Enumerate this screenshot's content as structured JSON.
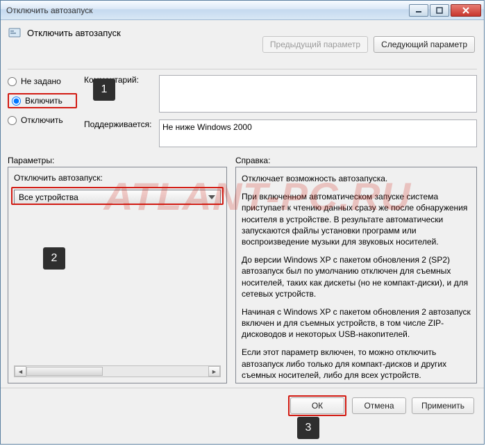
{
  "window": {
    "title": "Отключить автозапуск"
  },
  "header": {
    "title": "Отключить автозапуск"
  },
  "nav": {
    "prev": "Предыдущий параметр",
    "next": "Следующий параметр"
  },
  "radios": {
    "not_configured": "Не задано",
    "enabled": "Включить",
    "disabled": "Отключить",
    "selected": "enabled"
  },
  "labels": {
    "comment": "Комментарий:",
    "supported": "Поддерживается:",
    "parameters": "Параметры:",
    "help": "Справка:",
    "param_inner_label": "Отключить автозапуск:"
  },
  "supported_text": "Не ниже Windows 2000",
  "comment_value": "",
  "combo": {
    "value": "Все устройства"
  },
  "help": {
    "p1": "Отключает возможность автозапуска.",
    "p2": "При включенном автоматическом запуске система приступает к чтению данных сразу же после обнаружения носителя в устройстве. В результате автоматически запускаются файлы установки программ или воспроизведение музыки для звуковых носителей.",
    "p3": "До версии Windows XP с пакетом обновления 2 (SP2) автозапуск был по умолчанию отключен для съемных носителей, таких как дискеты (но не компакт-диски), и для сетевых устройств.",
    "p4": "Начиная с Windows XP с пакетом обновления 2 автозапуск включен и для съемных устройств, в том числе ZIP-дисководов и некоторых USB-накопителей.",
    "p5": "Если этот параметр включен, то можно отключить автозапуск либо только для компакт-дисков и других съемных носителей, либо для всех устройств."
  },
  "buttons": {
    "ok": "ОК",
    "cancel": "Отмена",
    "apply": "Применить"
  },
  "annotations": {
    "b1": "1",
    "b2": "2",
    "b3": "3"
  },
  "watermark": "ATLANT-PC.RU"
}
